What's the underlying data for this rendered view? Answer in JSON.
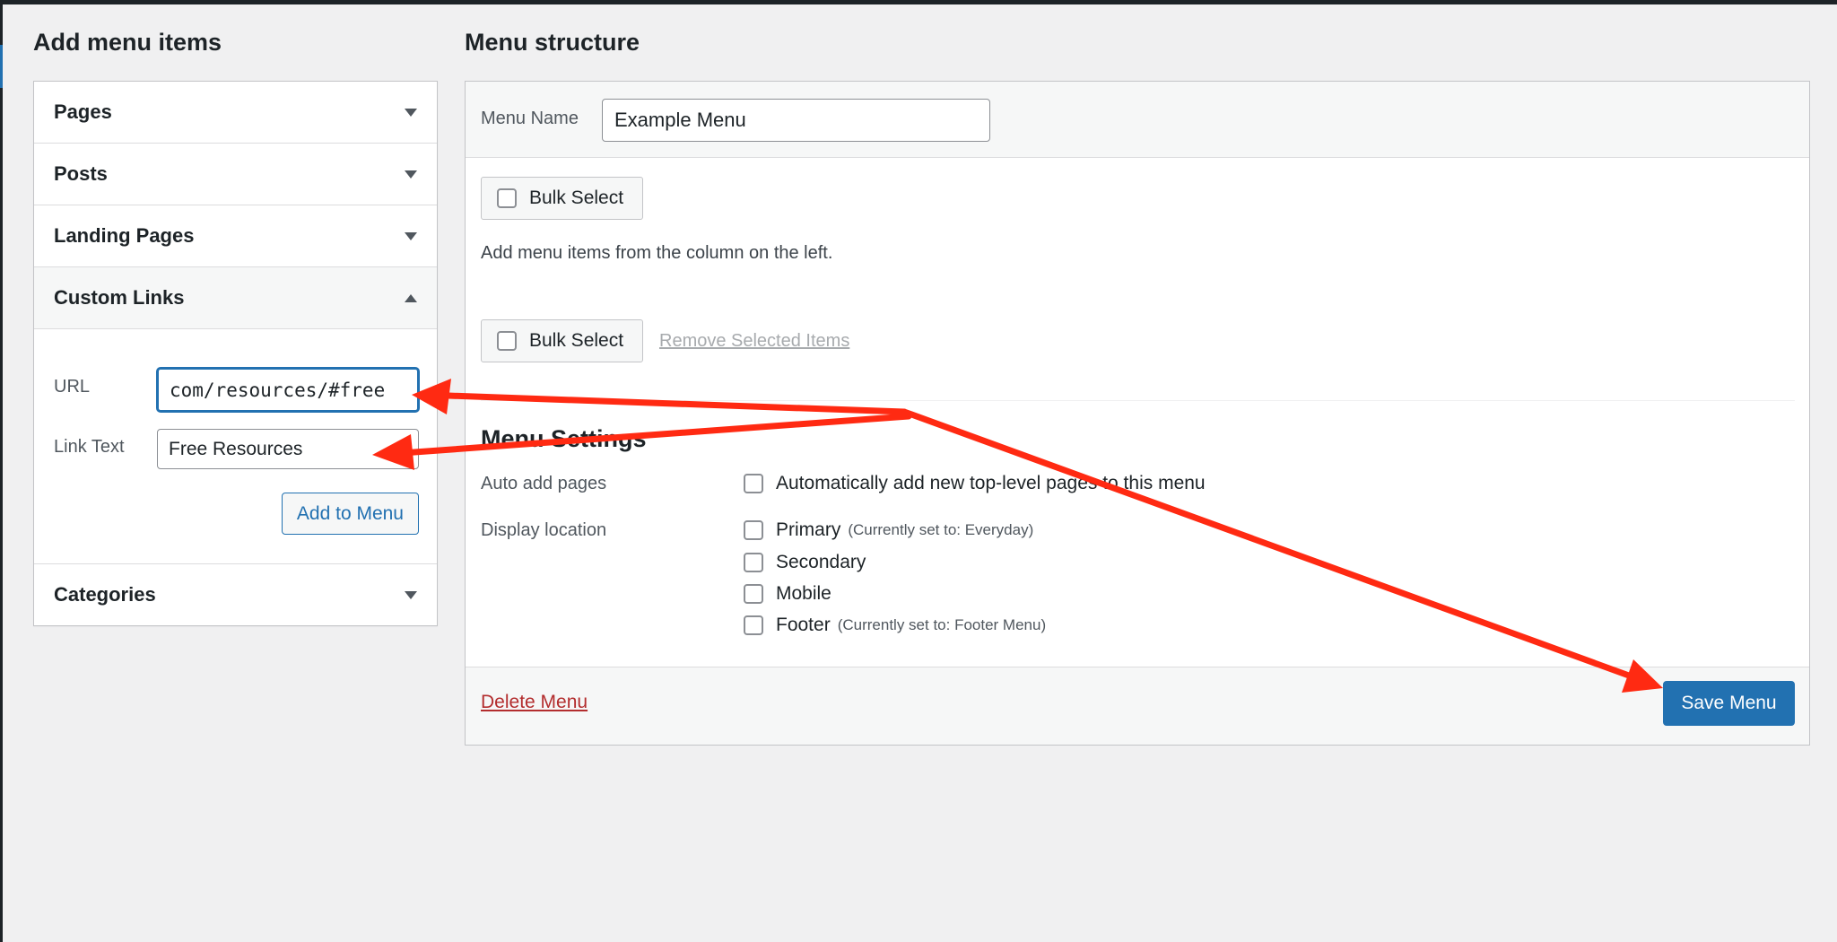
{
  "left": {
    "title": "Add menu items",
    "sections": {
      "pages": "Pages",
      "posts": "Posts",
      "landing_pages": "Landing Pages",
      "custom_links": "Custom Links",
      "categories": "Categories"
    },
    "custom_links": {
      "url_label": "URL",
      "url_value": "com/resources/#free",
      "link_text_label": "Link Text",
      "link_text_value": "Free Resources",
      "add_button": "Add to Menu"
    }
  },
  "right": {
    "title": "Menu structure",
    "menu_name_label": "Menu Name",
    "menu_name_value": "Example Menu",
    "bulk_select_label": "Bulk Select",
    "info_text": "Add menu items from the column on the left.",
    "remove_selected": "Remove Selected Items",
    "settings": {
      "title": "Menu Settings",
      "auto_add_label": "Auto add pages",
      "auto_add_option": "Automatically add new top-level pages to this menu",
      "display_location_label": "Display location",
      "locations": [
        {
          "label": "Primary",
          "note": "(Currently set to: Everyday)"
        },
        {
          "label": "Secondary",
          "note": ""
        },
        {
          "label": "Mobile",
          "note": ""
        },
        {
          "label": "Footer",
          "note": "(Currently set to: Footer Menu)"
        }
      ]
    },
    "delete_menu": "Delete Menu",
    "save_menu": "Save Menu"
  },
  "colors": {
    "accent": "#2271b1",
    "annotation": "#ff2a12",
    "danger": "#b32d2e"
  }
}
